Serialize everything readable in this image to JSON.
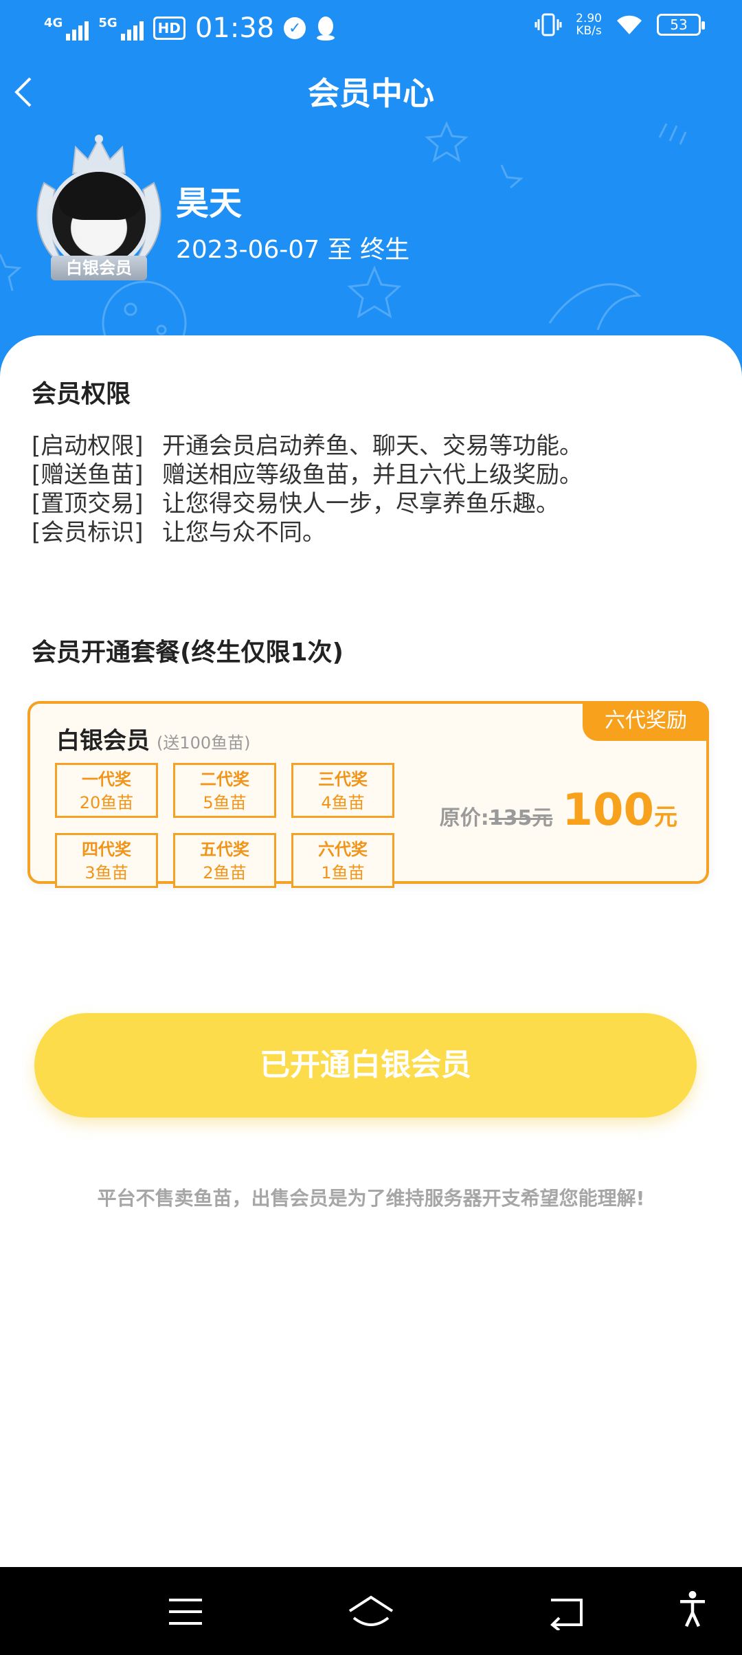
{
  "status_bar": {
    "signal1": "4G",
    "signal2": "5G",
    "hd": "HD",
    "time": "01:38",
    "speed_value": "2.90",
    "speed_unit": "KB/s",
    "battery": "53"
  },
  "header": {
    "title": "会员中心"
  },
  "profile": {
    "name": "昊天",
    "validity": "2023-06-07 至 终生",
    "member_tag": "白银会员"
  },
  "rights": {
    "title": "会员权限",
    "items": [
      {
        "tag": "[启动权限]",
        "text": "开通会员启动养鱼、聊天、交易等功能。"
      },
      {
        "tag": "[赠送鱼苗]",
        "text": "赠送相应等级鱼苗，并且六代上级奖励。"
      },
      {
        "tag": "[置顶交易]",
        "text": "让您得交易快人一步，尽享养鱼乐趣。"
      },
      {
        "tag": "[会员标识]",
        "text": "让您与众不同。"
      }
    ]
  },
  "package": {
    "title": "会员开通套餐(终生仅限1次)",
    "badge": "六代奖励",
    "name": "白银会员",
    "note": "(送100鱼苗)",
    "rewards": [
      {
        "gen": "一代奖",
        "amount": "20鱼苗"
      },
      {
        "gen": "二代奖",
        "amount": "5鱼苗"
      },
      {
        "gen": "三代奖",
        "amount": "4鱼苗"
      },
      {
        "gen": "四代奖",
        "amount": "3鱼苗"
      },
      {
        "gen": "五代奖",
        "amount": "2鱼苗"
      },
      {
        "gen": "六代奖",
        "amount": "1鱼苗"
      }
    ],
    "orig_label": "原价:",
    "orig_price": "135元",
    "price": "100",
    "price_unit": "元"
  },
  "cta": {
    "label": "已开通白银会员"
  },
  "footnote": "平台不售卖鱼苗，出售会员是为了维持服务器开支希望您能理解!",
  "colors": {
    "header_bg": "#1e90f5",
    "accent_orange": "#f7a11c",
    "cta_yellow": "#fddc4b"
  }
}
